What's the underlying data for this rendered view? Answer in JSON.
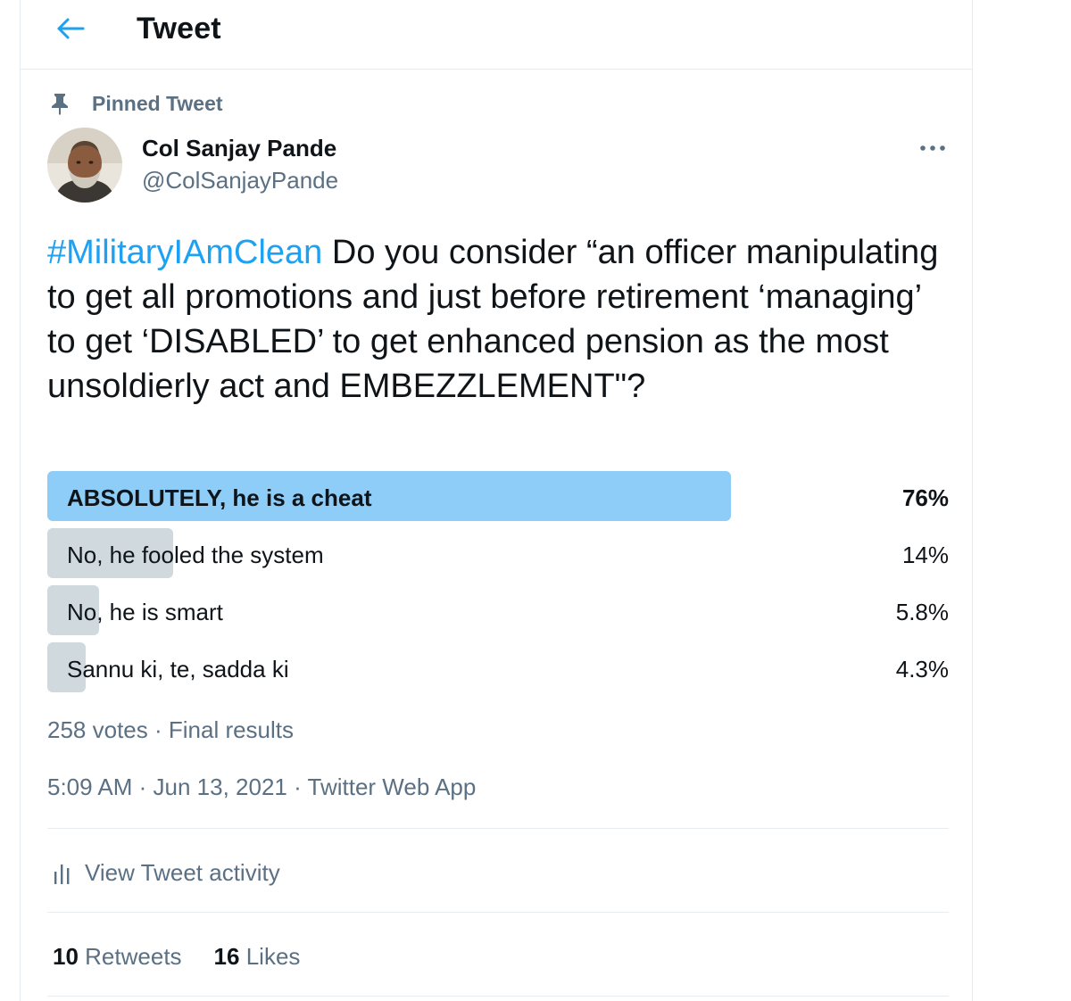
{
  "header": {
    "back_icon": "arrow-left-icon",
    "title": "Tweet"
  },
  "tweet": {
    "pinned_label": "Pinned Tweet",
    "pin_icon": "pin-icon",
    "author": {
      "name": "Col Sanjay Pande",
      "handle": "@ColSanjayPande"
    },
    "more_icon": "more-options-icon",
    "hashtag": "#MilitaryIAmClean",
    "text": " Do you consider “an officer manipulating to get all promotions and just before retirement ‘managing’ to get ‘DISABLED’ to get enhanced pension as the most unsoldierly act and EMBEZZLEMENT\"?",
    "poll": {
      "options": [
        {
          "label": "ABSOLUTELY, he is a cheat",
          "percent_text": "76%",
          "percent": 76,
          "winner": true
        },
        {
          "label": "No, he fooled the system",
          "percent_text": "14%",
          "percent": 14,
          "winner": false
        },
        {
          "label": "No, he is smart",
          "percent_text": "5.8%",
          "percent": 5.8,
          "winner": false
        },
        {
          "label": "Sannu ki, te, sadda ki",
          "percent_text": "4.3%",
          "percent": 4.3,
          "winner": false
        }
      ],
      "votes": "258 votes",
      "status": "Final results"
    },
    "time": "5:09 AM",
    "date": "Jun 13, 2021",
    "source": "Twitter Web App",
    "activity_label": "View Tweet activity",
    "activity_icon": "bar-chart-icon",
    "stats": {
      "retweets_count": "10",
      "retweets_label": "Retweets",
      "likes_count": "16",
      "likes_label": "Likes"
    },
    "colors": {
      "accent": "#1da1f2",
      "winner_bar": "#8ecdf8",
      "other_bar": "#cfd9de",
      "secondary_text": "#5b7083"
    }
  }
}
